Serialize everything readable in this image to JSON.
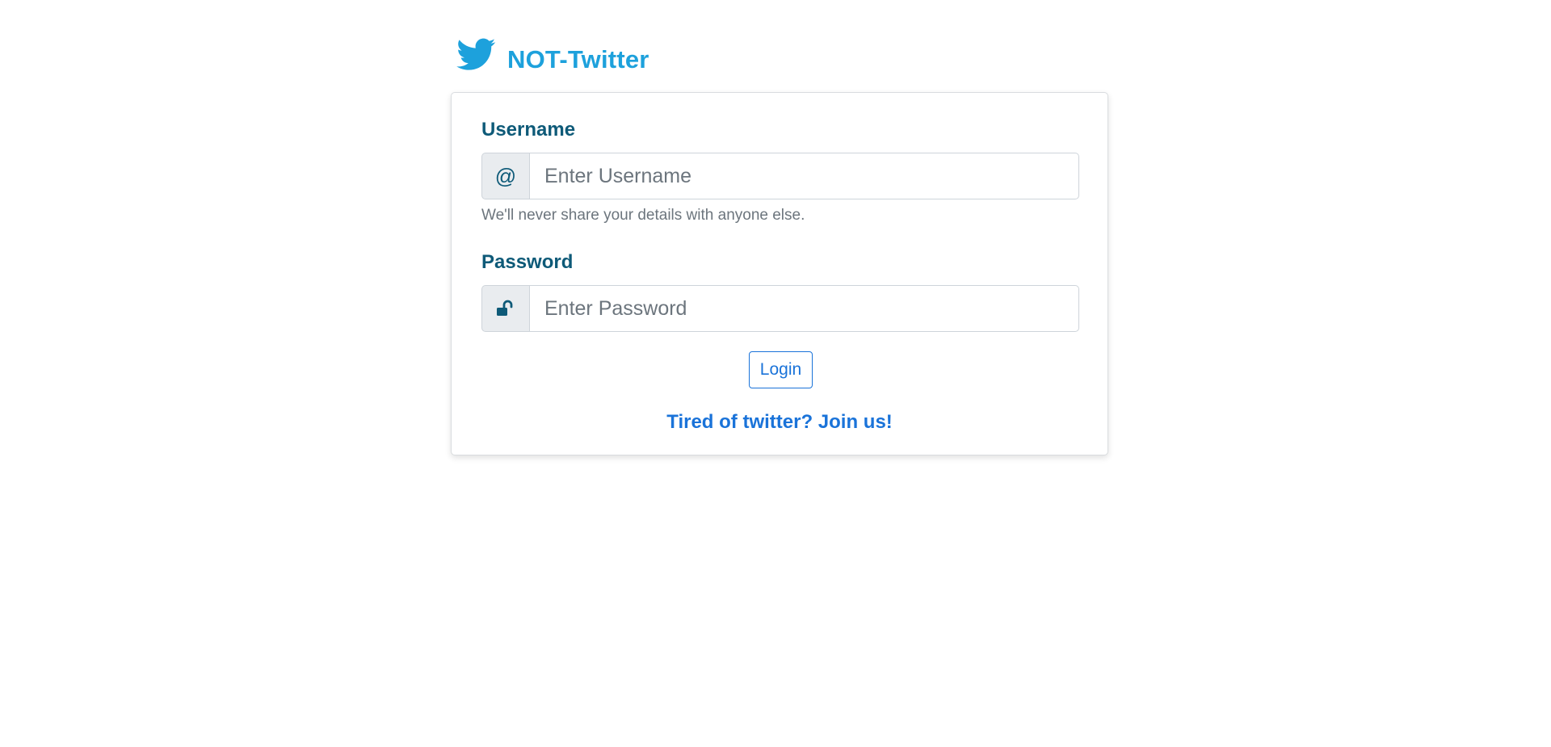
{
  "brand": {
    "name": "NOT-Twitter",
    "icon": "twitter-bird-icon",
    "color": "#1da1dc"
  },
  "form": {
    "username": {
      "label": "Username",
      "addon_symbol": "@",
      "placeholder": "Enter Username",
      "value": "",
      "help_text": "We'll never share your details with anyone else."
    },
    "password": {
      "label": "Password",
      "addon_icon": "unlock-icon",
      "placeholder": "Enter Password",
      "value": ""
    },
    "login_label": "Login",
    "join_label": "Tired of twitter? Join us!"
  },
  "colors": {
    "label": "#0e5a78",
    "primary": "#1a73d9",
    "muted": "#6c757d"
  }
}
